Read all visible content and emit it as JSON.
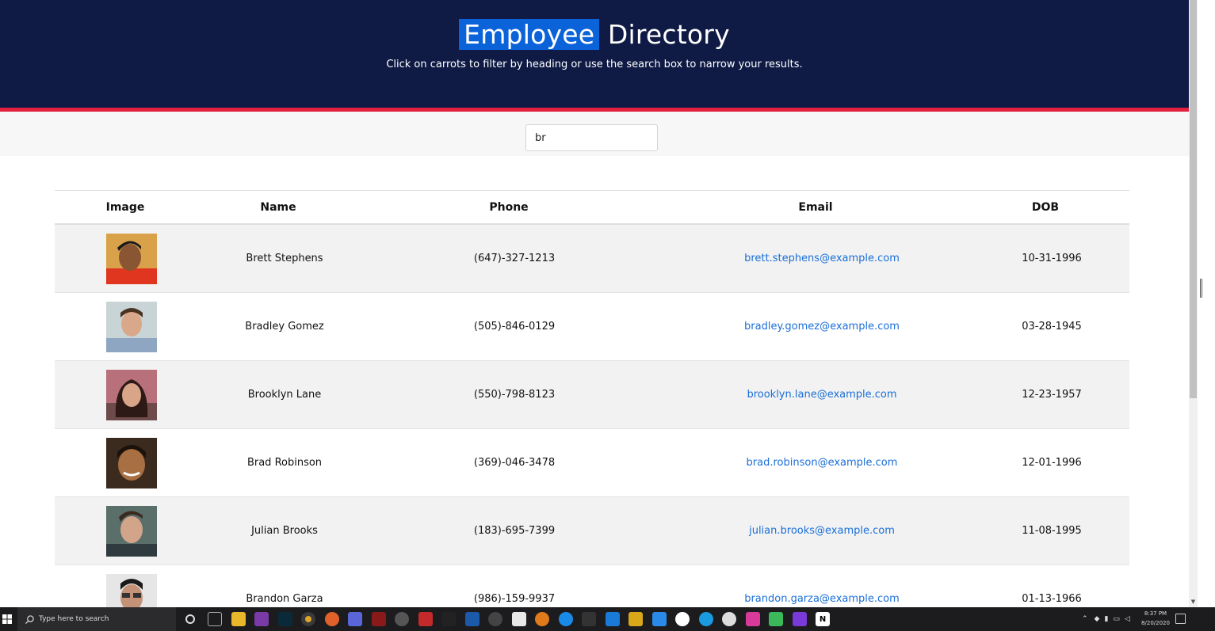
{
  "header": {
    "title_highlighted": "Employee",
    "title_rest": " Directory",
    "subtitle": "Click on carrots to filter by heading or use the search box to narrow your results."
  },
  "search": {
    "value": "br"
  },
  "table": {
    "columns": [
      "Image",
      "Name",
      "Phone",
      "Email",
      "DOB"
    ],
    "rows": [
      {
        "name": "Brett Stephens",
        "phone": "(647)-327-1213",
        "email": "brett.stephens@example.com",
        "dob": "10-31-1996",
        "avatar": "avatar-photo"
      },
      {
        "name": "Bradley Gomez",
        "phone": "(505)-846-0129",
        "email": "bradley.gomez@example.com",
        "dob": "03-28-1945",
        "avatar": "avatar-photo"
      },
      {
        "name": "Brooklyn Lane",
        "phone": "(550)-798-8123",
        "email": "brooklyn.lane@example.com",
        "dob": "12-23-1957",
        "avatar": "avatar-photo"
      },
      {
        "name": "Brad Robinson",
        "phone": "(369)-046-3478",
        "email": "brad.robinson@example.com",
        "dob": "12-01-1996",
        "avatar": "avatar-photo"
      },
      {
        "name": "Julian Brooks",
        "phone": "(183)-695-7399",
        "email": "julian.brooks@example.com",
        "dob": "11-08-1995",
        "avatar": "avatar-photo"
      },
      {
        "name": "Brandon Garza",
        "phone": "(986)-159-9937",
        "email": "brandon.garza@example.com",
        "dob": "01-13-1966",
        "avatar": "avatar-photo"
      }
    ]
  },
  "taskbar": {
    "search_placeholder": "Type here to search",
    "clock_time": "8:37 PM",
    "clock_date": "8/20/2020"
  },
  "colors": {
    "header_bg": "#0f1b45",
    "accent": "#e3213f",
    "highlight": "#0b63d9",
    "link": "#1a6fd8"
  }
}
